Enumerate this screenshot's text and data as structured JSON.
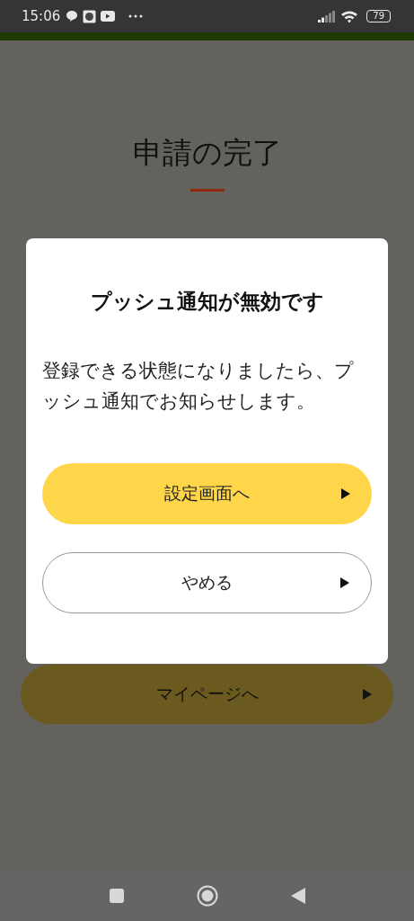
{
  "status_bar": {
    "time": "15:06",
    "battery": "79"
  },
  "page": {
    "title": "申請の完了",
    "button": "マイページへ"
  },
  "dialog": {
    "title": "プッシュ通知が無効です",
    "message": "登録できる状態になりましたら、プッシュ通知でお知らせします。",
    "buttons": [
      {
        "label": "設定画面へ",
        "kind": "primary"
      },
      {
        "label": "やめる",
        "kind": "secondary"
      }
    ]
  }
}
